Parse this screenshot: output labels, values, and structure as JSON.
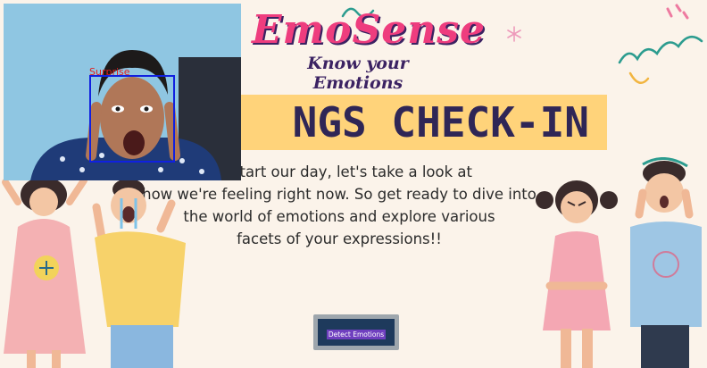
{
  "app": {
    "title": "EmoSense",
    "tagline": "Know your Emotions"
  },
  "banner": {
    "heading": "NGS CHECK-IN"
  },
  "intro": {
    "lines": [
      "we start our day, let's take a look at",
      "how we're feeling right now. So get ready to dive into",
      "the world of emotions and explore various",
      "facets of your expressions!!"
    ]
  },
  "webcam": {
    "detected_emotion": "Surprise"
  },
  "actions": {
    "detect_label": "Detect Emotions"
  },
  "colors": {
    "background": "#fbf3ea",
    "title_pink": "#ee3d7e",
    "title_shadow": "#3b2262",
    "banner_yellow": "#ffd37a",
    "button_bg": "#1e3a5c",
    "face_box": "#1020e0",
    "face_label": "#e02020"
  }
}
